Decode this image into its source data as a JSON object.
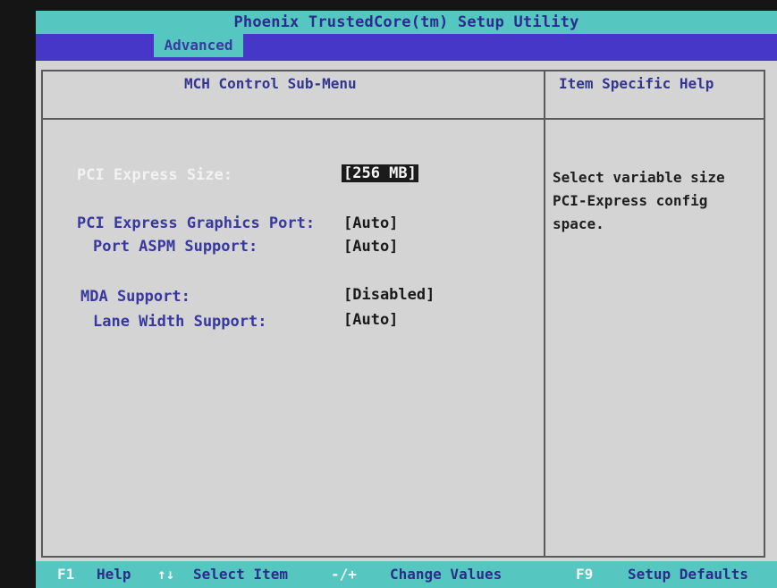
{
  "header": {
    "title": "Phoenix TrustedCore(tm) Setup Utility"
  },
  "menu": {
    "active_tab": "Advanced"
  },
  "main": {
    "title": "MCH Control Sub-Menu",
    "settings": [
      {
        "label": "PCI Express Size:",
        "value": "[256 MB]",
        "selected": true
      },
      {
        "label": "PCI Express Graphics Port:",
        "value": "[Auto]"
      },
      {
        "label": "Port ASPM Support:",
        "value": "[Auto]"
      },
      {
        "label": "MDA Support:",
        "value": "[Disabled]"
      },
      {
        "label": "Lane Width Support:",
        "value": "[Auto]"
      }
    ]
  },
  "help": {
    "title": "Item Specific Help",
    "text": "Select variable size\nPCI-Express config\nspace."
  },
  "footer": {
    "keys": [
      {
        "key": "F1",
        "desc": "Help"
      },
      {
        "key": "↑↓",
        "desc": "Select Item"
      },
      {
        "key": "-/+",
        "desc": "Change Values"
      },
      {
        "key": "F9",
        "desc": "Setup Defaults"
      }
    ]
  },
  "colors": {
    "title_bar": "#56c7c0",
    "menu_bar": "#4637c8",
    "panel_bg": "#d4d4d4",
    "label_text": "#38389e",
    "selected_highlight": "#1b1b1b"
  }
}
